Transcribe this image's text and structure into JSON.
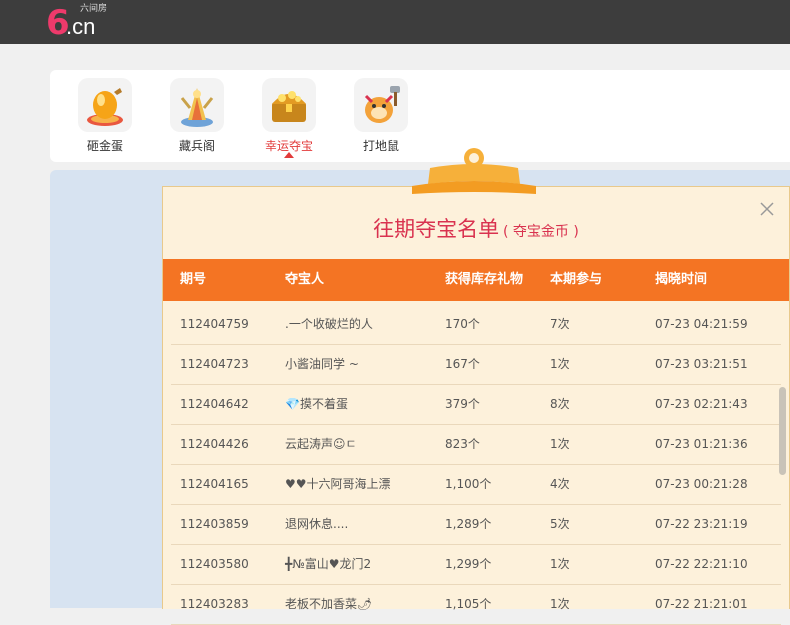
{
  "header": {
    "logo_mark": "6",
    "logo_domain": ".cn",
    "logo_subtitle": "六间房"
  },
  "game_tabs": [
    {
      "label": "砸金蛋",
      "icon": "golden-egg-icon",
      "active": false
    },
    {
      "label": "藏兵阁",
      "icon": "armory-icon",
      "active": false
    },
    {
      "label": "幸运夺宝",
      "icon": "treasure-chest-icon",
      "active": true
    },
    {
      "label": "打地鼠",
      "icon": "whack-a-mole-icon",
      "active": false
    }
  ],
  "modal": {
    "title": "往期夺宝名单",
    "subtitle": "( 夺宝金币 )",
    "columns": [
      "期号",
      "夺宝人",
      "获得库存礼物",
      "本期参与",
      "揭晓时间"
    ],
    "rows": [
      {
        "issue": "112404759",
        "winner": ".一个收破烂的人",
        "gifts": "170个",
        "participation": "7次",
        "time": "07-23 04:21:59"
      },
      {
        "issue": "112404723",
        "winner": "小酱油同学 ~",
        "gifts": "167个",
        "participation": "1次",
        "time": "07-23 03:21:51"
      },
      {
        "issue": "112404642",
        "winner": "💎摸不着蛋",
        "gifts": "379个",
        "participation": "8次",
        "time": "07-23 02:21:43"
      },
      {
        "issue": "112404426",
        "winner": "云起涛声☺ㄷ",
        "gifts": "823个",
        "participation": "1次",
        "time": "07-23 01:21:36"
      },
      {
        "issue": "112404165",
        "winner": "♥♥十六阿哥海上漂",
        "gifts": "1,100个",
        "participation": "4次",
        "time": "07-23 00:21:28"
      },
      {
        "issue": "112403859",
        "winner": "退网休息....",
        "gifts": "1,289个",
        "participation": "5次",
        "time": "07-22 23:21:19"
      },
      {
        "issue": "112403580",
        "winner": "╋№富山♥龙门2",
        "gifts": "1,299个",
        "participation": "1次",
        "time": "07-22 22:21:10"
      },
      {
        "issue": "112403283",
        "winner": "老板不加香菜🌶",
        "gifts": "1,105个",
        "participation": "1次",
        "time": "07-22 21:21:01"
      }
    ]
  },
  "colors": {
    "topbar": "#3d3d3d",
    "brand_pink": "#ee3a6b",
    "table_header": "#f47423",
    "modal_bg": "#fdf1db",
    "title_red": "#d9324f",
    "active_tab": "#e23b3b"
  }
}
